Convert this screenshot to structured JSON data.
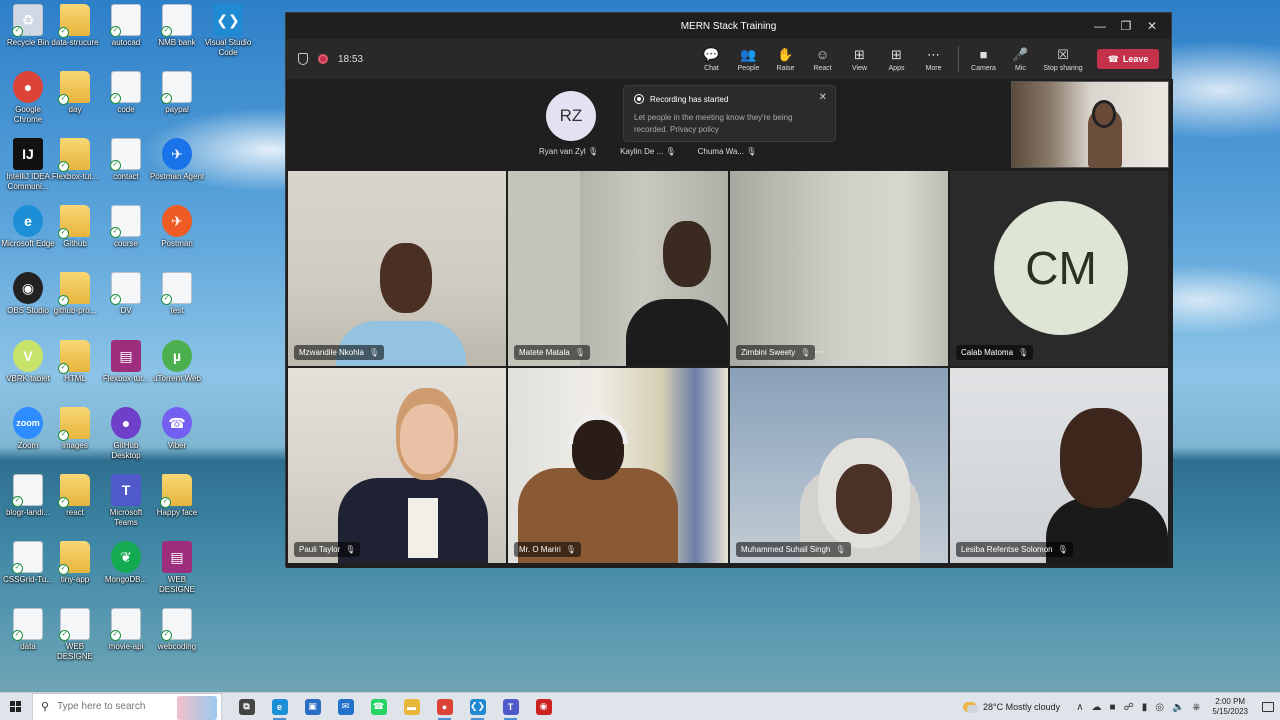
{
  "desktop": {
    "icons": [
      {
        "label": "Recycle Bin",
        "kind": "doc",
        "glyph": "♻",
        "color": "#cfd8e3"
      },
      {
        "label": "data-strucure",
        "kind": "folder",
        "glyph": "",
        "color": ""
      },
      {
        "label": "autocad",
        "kind": "doc",
        "glyph": "",
        "color": ""
      },
      {
        "label": "NMB bank",
        "kind": "doc",
        "glyph": "",
        "color": ""
      },
      {
        "label": "Visual Studio Code",
        "kind": "app",
        "glyph": "❮❯",
        "color": "#1f8ad2"
      },
      {
        "label": "Google Chrome",
        "kind": "round",
        "glyph": "●",
        "color": "#db4437"
      },
      {
        "label": "day",
        "kind": "folder",
        "glyph": "",
        "color": ""
      },
      {
        "label": "code",
        "kind": "doc",
        "glyph": "",
        "color": ""
      },
      {
        "label": "paypal",
        "kind": "doc",
        "glyph": "",
        "color": ""
      },
      {
        "label": "IntelliJ IDEA Communi...",
        "kind": "app",
        "glyph": "IJ",
        "color": "#111111"
      },
      {
        "label": "Flexbox-tut...",
        "kind": "folder",
        "glyph": "",
        "color": ""
      },
      {
        "label": "contact",
        "kind": "doc",
        "glyph": "",
        "color": ""
      },
      {
        "label": "Postman Agent",
        "kind": "round",
        "glyph": "✈",
        "color": "#1a73e8"
      },
      {
        "label": "Microsoft Edge",
        "kind": "round",
        "glyph": "e",
        "color": "#1c8fd6"
      },
      {
        "label": "Github",
        "kind": "folder",
        "glyph": "",
        "color": ""
      },
      {
        "label": "course",
        "kind": "doc",
        "glyph": "",
        "color": ""
      },
      {
        "label": "Postman",
        "kind": "round",
        "glyph": "✈",
        "color": "#ef5b25"
      },
      {
        "label": "OBS Studio",
        "kind": "round",
        "glyph": "◉",
        "color": "#222222"
      },
      {
        "label": "github-pro...",
        "kind": "folder",
        "glyph": "",
        "color": ""
      },
      {
        "label": "DV",
        "kind": "doc",
        "glyph": "",
        "color": ""
      },
      {
        "label": "test",
        "kind": "doc",
        "glyph": "",
        "color": ""
      },
      {
        "label": "VBRK tablet",
        "kind": "round",
        "glyph": "V",
        "color": "#c7e36a"
      },
      {
        "label": "HTML",
        "kind": "folder",
        "glyph": "",
        "color": ""
      },
      {
        "label": "Flexbox-tut...",
        "kind": "app",
        "glyph": "▤",
        "color": "#9c2e7d"
      },
      {
        "label": "uTorrent Web",
        "kind": "round",
        "glyph": "µ",
        "color": "#4caf50"
      },
      {
        "label": "Zoom",
        "kind": "round",
        "glyph": "zoom",
        "color": "#2d8cff"
      },
      {
        "label": "images",
        "kind": "folder",
        "glyph": "",
        "color": ""
      },
      {
        "label": "GitHub Desktop",
        "kind": "round",
        "glyph": "●",
        "color": "#6e40c9"
      },
      {
        "label": "Viber",
        "kind": "round",
        "glyph": "☎",
        "color": "#7360f2"
      },
      {
        "label": "blogr-landi...",
        "kind": "doc",
        "glyph": "",
        "color": ""
      },
      {
        "label": "react",
        "kind": "folder",
        "glyph": "",
        "color": ""
      },
      {
        "label": "Microsoft Teams",
        "kind": "app",
        "glyph": "T",
        "color": "#5059c9"
      },
      {
        "label": "Happy face",
        "kind": "folder",
        "glyph": "",
        "color": ""
      },
      {
        "label": "CSSGrid-Tu...",
        "kind": "doc",
        "glyph": "",
        "color": ""
      },
      {
        "label": "tiny-app",
        "kind": "folder",
        "glyph": "",
        "color": ""
      },
      {
        "label": "MongoDB...",
        "kind": "round",
        "glyph": "❦",
        "color": "#13aa52"
      },
      {
        "label": "WEB DESIGNE",
        "kind": "app",
        "glyph": "▤",
        "color": "#9c2e7d"
      },
      {
        "label": "data",
        "kind": "doc",
        "glyph": "",
        "color": ""
      },
      {
        "label": "WEB DESIGNE",
        "kind": "doc",
        "glyph": "",
        "color": ""
      },
      {
        "label": "movie-api",
        "kind": "doc",
        "glyph": "",
        "color": ""
      },
      {
        "label": "webcoding",
        "kind": "doc",
        "glyph": "",
        "color": ""
      }
    ]
  },
  "teams": {
    "window_title": "MERN Stack Training",
    "timer": "18:53",
    "toolbar": [
      {
        "label": "Chat",
        "icon": "chat-icon",
        "glyph": "💬"
      },
      {
        "label": "People",
        "icon": "people-icon",
        "glyph": "👥"
      },
      {
        "label": "Raise",
        "icon": "raise-hand-icon",
        "glyph": "✋"
      },
      {
        "label": "React",
        "icon": "react-icon",
        "glyph": "☺"
      },
      {
        "label": "View",
        "icon": "view-icon",
        "glyph": "⊞"
      },
      {
        "label": "Apps",
        "icon": "apps-icon",
        "glyph": "⊞"
      },
      {
        "label": "More",
        "icon": "more-icon",
        "glyph": "⋯"
      }
    ],
    "device_controls": [
      {
        "label": "Camera",
        "icon": "camera-icon",
        "glyph": "■"
      },
      {
        "label": "Mic",
        "icon": "mic-icon",
        "glyph": "🎤"
      },
      {
        "label": "Stop sharing",
        "icon": "stop-sharing-icon",
        "glyph": "☒"
      }
    ],
    "leave_label": "Leave",
    "roster": {
      "avatar_initials": "RZ",
      "names": [
        "Ryan van Zyl",
        "Kaylin De ...",
        "Chuma Wa..."
      ]
    },
    "toast": {
      "title": "Recording has started",
      "body_1": "Let people in the meeting know they're being",
      "body_2": "recorded. Privacy policy"
    },
    "tiles": [
      {
        "name": "Mzwandile Nkohla"
      },
      {
        "name": "Matete Matala"
      },
      {
        "name": "Zimbini Sweety"
      },
      {
        "name": "Calab Matoma",
        "initials": "CM"
      },
      {
        "name": "Pauli Taylor"
      },
      {
        "name": "Mr. O Mariri"
      },
      {
        "name": "Muhammed Suhail Singh"
      },
      {
        "name": "Lesiba Refentse Solomon"
      }
    ]
  },
  "taskbar": {
    "search_placeholder": "Type here to search",
    "weather": "28°C  Mostly cloudy",
    "time": "2:00 PM",
    "date": "5/15/2023",
    "apps": [
      {
        "name": "task-view",
        "glyph": "⧉",
        "color": "#444444"
      },
      {
        "name": "edge",
        "glyph": "e",
        "color": "#1c8fd6"
      },
      {
        "name": "store",
        "glyph": "▣",
        "color": "#2b6cc4"
      },
      {
        "name": "mail",
        "glyph": "✉",
        "color": "#2372c9"
      },
      {
        "name": "whatsapp",
        "glyph": "☎",
        "color": "#25d366"
      },
      {
        "name": "file-explorer",
        "glyph": "▬",
        "color": "#e9b63c"
      },
      {
        "name": "chrome",
        "glyph": "●",
        "color": "#db4437"
      },
      {
        "name": "vscode",
        "glyph": "❮❯",
        "color": "#1f8ad2"
      },
      {
        "name": "teams",
        "glyph": "T",
        "color": "#5059c9"
      },
      {
        "name": "recorder",
        "glyph": "◉",
        "color": "#cc2222"
      }
    ]
  }
}
